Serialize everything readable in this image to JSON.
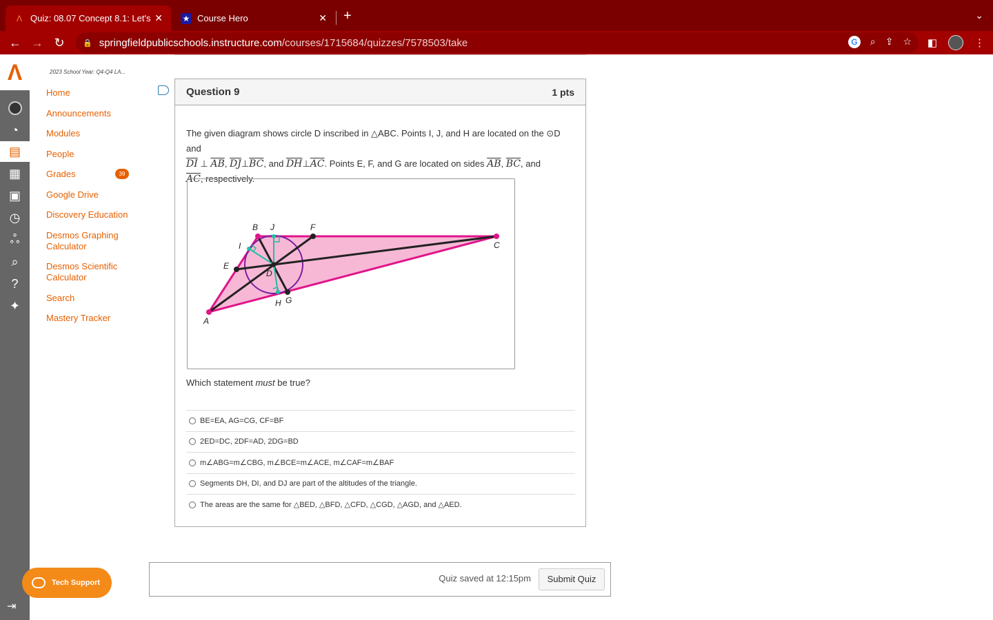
{
  "browser": {
    "tabs": [
      {
        "title": "Quiz: 08.07 Concept 8.1: Let's",
        "favicon": "canvas-icon",
        "active": true
      },
      {
        "title": "Course Hero",
        "favicon": "star-icon",
        "active": false
      }
    ],
    "url_domain": "springfieldpublicschools.instructure.com",
    "url_path": "/courses/1715684/quizzes/7578503/take",
    "chrome_color": "#a30000"
  },
  "course": {
    "label": "2023 School Year: Q4-Q4 LA...",
    "nav": [
      {
        "label": "Home"
      },
      {
        "label": "Announcements"
      },
      {
        "label": "Modules"
      },
      {
        "label": "People"
      },
      {
        "label": "Grades",
        "badge": "39"
      },
      {
        "label": "Google Drive"
      },
      {
        "label": "Discovery Education"
      },
      {
        "label": "Desmos Graphing Calculator"
      },
      {
        "label": "Desmos Scientific Calculator"
      },
      {
        "label": "Search"
      },
      {
        "label": "Mastery Tracker"
      }
    ],
    "accent": "#e66000"
  },
  "question": {
    "title": "Question 9",
    "points": "1 pts",
    "text1": "The given diagram shows circle D inscribed in △ABC. Points I, J, and H are located on the ⊙D and",
    "prompt": "Which statement must be true?",
    "diagram_labels": {
      "A": "A",
      "B": "B",
      "C": "C",
      "D": "D",
      "E": "E",
      "F": "F",
      "G": "G",
      "H": "H",
      "I": "I",
      "J": "J"
    },
    "answers": [
      "BE=EA, AG=CG, CF=BF",
      "2ED=DC, 2DF=AD, 2DG=BD",
      "m∠ABG=m∠CBG, m∠BCE=m∠ACE, m∠CAF=m∠BAF",
      "Segments DH, DI, and DJ are part of the altitudes of the triangle.",
      "The areas are the same for △BED, △BFD, △CFD, △CGD, △AGD, and △AED."
    ]
  },
  "footer": {
    "saved": "Quiz saved at 12:15pm",
    "submit": "Submit Quiz",
    "tech_support": "Tech Support"
  }
}
